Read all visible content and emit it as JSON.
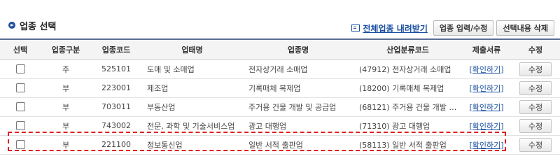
{
  "section": {
    "title": "업종 선택"
  },
  "toolbar": {
    "download_label": "전체업종 내려받기",
    "input_edit_label": "업종 입력/수정",
    "delete_selected_label": "선택내용 삭제"
  },
  "table": {
    "headers": [
      "선택",
      "업종구분",
      "업종코드",
      "업태명",
      "업종명",
      "산업분류코드",
      "제출서류",
      "수정"
    ],
    "rows": [
      {
        "type": "주",
        "code": "525101",
        "business_type": "도매 및 소매업",
        "industry": "전자상거래 소매업",
        "ksic": "(47912) 전자상거래 소매업",
        "docs": "[확인하기]",
        "edit": "수정"
      },
      {
        "type": "부",
        "code": "223001",
        "business_type": "제조업",
        "industry": "기록매체 복제업",
        "ksic": "(18200) 기록매체 복제업",
        "docs": "[확인하기]",
        "edit": "수정"
      },
      {
        "type": "부",
        "code": "703011",
        "business_type": "부동산업",
        "industry": "주거용 건물 개발 및 공급업",
        "ksic": "(68121) 주거용 건물 개발 및 …",
        "docs": "[확인하기]",
        "edit": "수정"
      },
      {
        "type": "부",
        "code": "743002",
        "business_type": "전문, 과학 및 기술서비스업",
        "industry": "광고 대행업",
        "ksic": "(71310) 광고 대행업",
        "docs": "[확인하기]",
        "edit": "수정"
      },
      {
        "type": "부",
        "code": "221100",
        "business_type": "정보통신업",
        "industry": "일반 서적 출판업",
        "ksic": "(58113) 일반 서적 출판업",
        "docs": "[확인하기]",
        "edit": "수정"
      }
    ]
  },
  "colors": {
    "highlight": "#e02020",
    "link": "#1a4fa0",
    "header_border": "#5a6d92"
  }
}
